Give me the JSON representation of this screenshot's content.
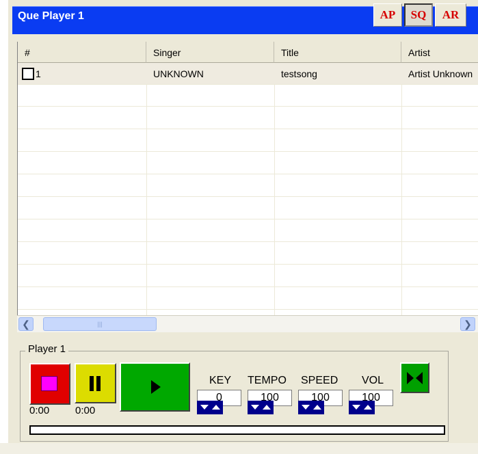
{
  "window": {
    "title": "Que Player 1"
  },
  "mode_buttons": {
    "ap": "AP",
    "sq": "SQ",
    "ar": "AR"
  },
  "columns": [
    "#",
    "Singer",
    "Title",
    "Artist"
  ],
  "rows": [
    {
      "num": "1",
      "singer": "UNKNOWN",
      "title": "testsong",
      "artist": "Artist Unknown",
      "checked": false
    }
  ],
  "player": {
    "label": "Player 1",
    "stop_time": "0:00",
    "pause_time": "0:00",
    "controls": {
      "key_label": "KEY",
      "key_value": "0",
      "tempo_label": "TEMPO",
      "tempo_value": "100",
      "speed_label": "SPEED",
      "speed_value": "100",
      "vol_label": "VOL",
      "vol_value": "100"
    },
    "progress": 0
  },
  "colors": {
    "titlebar": "#0a3cf2",
    "stop": "#e00000",
    "pause": "#dcdc00",
    "play": "#00a800",
    "arrow_pad": "#00008c"
  }
}
